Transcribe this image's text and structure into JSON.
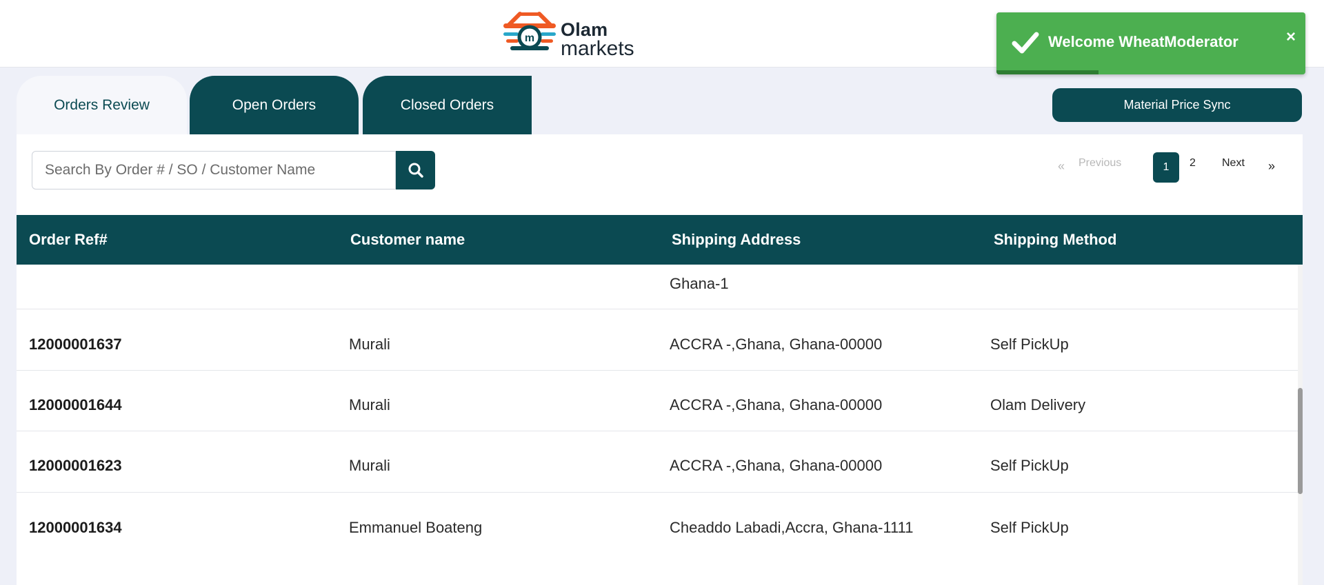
{
  "brand": {
    "word1": "Olam",
    "word2": "markets",
    "colors": {
      "orange": "#ef5a24",
      "teal": "#0b4a52",
      "cyan": "#29a7c9"
    }
  },
  "toast": {
    "message": "Welcome WheatModerator",
    "close_glyph": "×",
    "icon": "check-icon",
    "background": "#4caf50",
    "progress_fraction": 0.33
  },
  "tabs": [
    {
      "label": "Orders Review",
      "active": true
    },
    {
      "label": "Open Orders",
      "active": false
    },
    {
      "label": "Closed Orders",
      "active": false
    }
  ],
  "actions": {
    "sync_label": "Material Price Sync"
  },
  "search": {
    "placeholder": "Search By Order # / SO / Customer Name",
    "value": "",
    "icon": "search-icon"
  },
  "pagination": {
    "prev_arrow": "«",
    "prev_label": "Previous",
    "pages": [
      "1",
      "2"
    ],
    "current_page": "1",
    "next_label": "Next",
    "next_arrow": "»"
  },
  "table": {
    "columns": [
      "Order Ref#",
      "Customer name",
      "Shipping Address",
      "Shipping Method"
    ],
    "partial_row": {
      "address": "Ghana-1"
    },
    "rows": [
      {
        "ref": "12000001637",
        "customer": "Murali",
        "address": "ACCRA -,Ghana, Ghana-00000",
        "method": "Self PickUp"
      },
      {
        "ref": "12000001644",
        "customer": "Murali",
        "address": "ACCRA -,Ghana, Ghana-00000",
        "method": "Olam Delivery"
      },
      {
        "ref": "12000001623",
        "customer": "Murali",
        "address": "ACCRA -,Ghana, Ghana-00000",
        "method": "Self PickUp"
      },
      {
        "ref": "12000001634",
        "customer": "Emmanuel Boateng",
        "address": "Cheaddo Labadi,Accra, Ghana-1111",
        "method": "Self PickUp"
      }
    ]
  },
  "theme": {
    "primary": "#0b4a52",
    "page_bg": "#eef0f8"
  }
}
